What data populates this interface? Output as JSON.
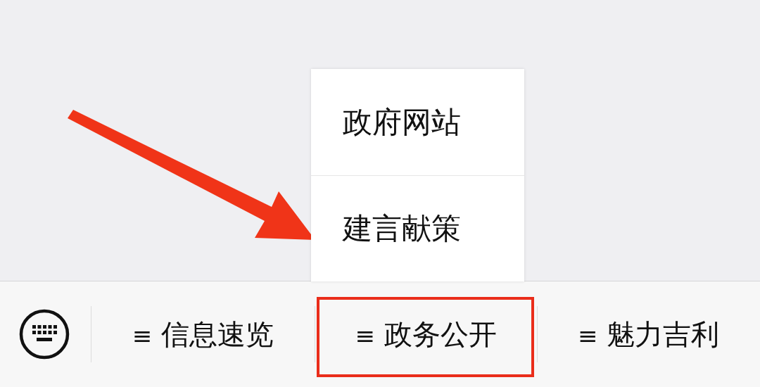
{
  "menu_bar": {
    "menus": [
      {
        "icon": "≡",
        "label": "信息速览",
        "expanded": false,
        "highlighted": false
      },
      {
        "icon": "≡",
        "label": "政务公开",
        "expanded": true,
        "highlighted": true,
        "submenu": [
          {
            "label": "政府网站"
          },
          {
            "label": "建言献策"
          }
        ]
      },
      {
        "icon": "≡",
        "label": "魅力吉利",
        "expanded": false,
        "highlighted": false
      }
    ]
  },
  "annotation": {
    "arrow": true
  }
}
